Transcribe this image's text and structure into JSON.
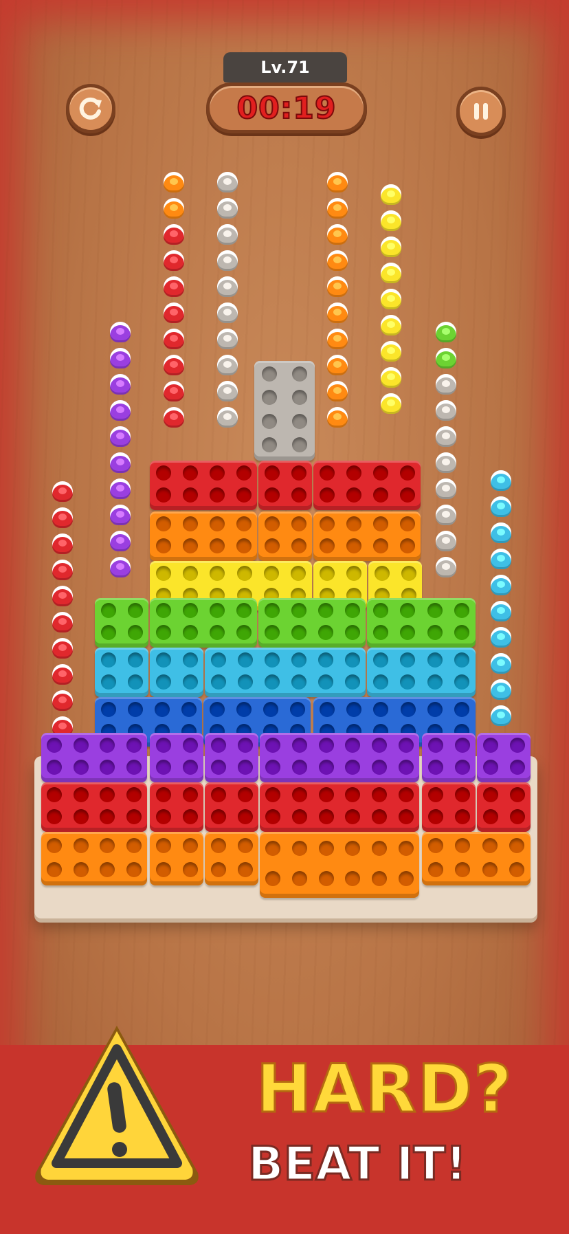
{
  "hud": {
    "level": "Lv.71",
    "timer": "00:19",
    "restart_icon": "restart-icon",
    "pause_icon": "pause-icon"
  },
  "banner": {
    "headline": "HARD?",
    "subline": "BEAT IT!",
    "warning_icon": "warning-icon"
  },
  "colors": {
    "red": "#e0282d",
    "orange": "#ff8a12",
    "yellow": "#fbe52a",
    "green": "#6cd332",
    "cyan": "#3fbfe6",
    "blue": "#2a6ad6",
    "purple": "#9a3fe0",
    "gray": "#bdb7b0",
    "timer_red": "#e21f1f",
    "banner_red": "#c8342c"
  }
}
